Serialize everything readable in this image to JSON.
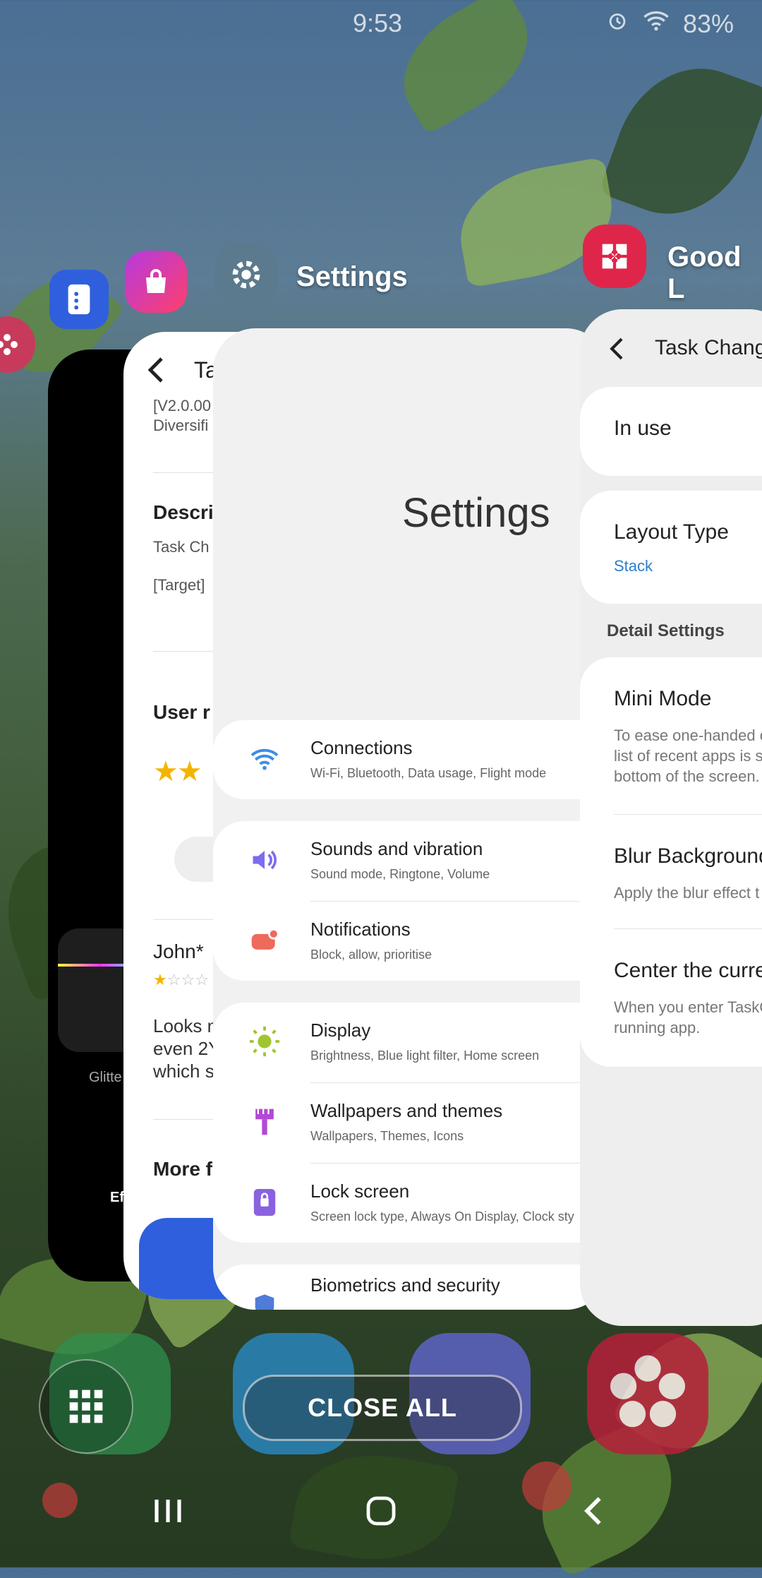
{
  "status_bar": {
    "time": "9:53",
    "battery": "83%"
  },
  "app_switcher": {
    "current_app_label": "Settings",
    "next_app_label": "Good L"
  },
  "store_card": {
    "header_title": "Ta",
    "version_fragment": "[V2.0.00",
    "category_fragment": "Diversifi",
    "description_heading": "Descri",
    "description_fragment": "Task Ch",
    "target_fragment": "[Target]",
    "reviews_heading": "User r",
    "reviewer": "John*",
    "review_line1": "Looks n",
    "review_line2": "even 2Y",
    "review_line3": "which s",
    "more_heading": "More f"
  },
  "black_card": {
    "label": "Glitte",
    "sublabel": "Ef"
  },
  "settings_card": {
    "big_title": "Settings",
    "items": [
      {
        "title": "Connections",
        "subtitle": "Wi-Fi, Bluetooth, Data usage, Flight mode",
        "icon": "wifi-icon"
      },
      {
        "title": "Sounds and vibration",
        "subtitle": "Sound mode, Ringtone, Volume",
        "icon": "volume-icon"
      },
      {
        "title": "Notifications",
        "subtitle": "Block, allow, prioritise",
        "icon": "notification-icon"
      },
      {
        "title": "Display",
        "subtitle": "Brightness, Blue light filter, Home screen",
        "icon": "sun-icon"
      },
      {
        "title": "Wallpapers and themes",
        "subtitle": "Wallpapers, Themes, Icons",
        "icon": "brush-icon"
      },
      {
        "title": "Lock screen",
        "subtitle": "Screen lock type, Always On Display, Clock sty",
        "icon": "lock-icon"
      },
      {
        "title": "Biometrics and security",
        "subtitle": "",
        "icon": "shield-icon"
      }
    ]
  },
  "task_card": {
    "title": "Task Change",
    "in_use": "In use",
    "layout_type_label": "Layout Type",
    "layout_type_value": "Stack",
    "detail_settings": "Detail Settings",
    "mini_mode": "Mini Mode",
    "mini_mode_desc1": "To ease one-handed o",
    "mini_mode_desc2": "list of recent apps is s",
    "mini_mode_desc3": "bottom of the screen.",
    "blur_bg": "Blur Background",
    "blur_desc": "Apply the blur effect t",
    "center_current": "Center the curren",
    "center_desc1": "When you enter TaskC",
    "center_desc2": "running app."
  },
  "dock": {
    "close_all": "CLOSE ALL"
  },
  "colors": {
    "accent_blue": "#2d7dc8",
    "star_yellow": "#f4b400",
    "good_lock_red": "#e0254a"
  }
}
